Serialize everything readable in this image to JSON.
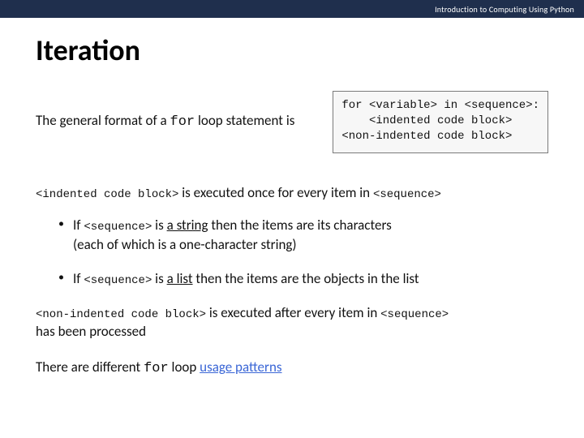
{
  "header": {
    "course": "Introduction to Computing Using Python"
  },
  "title": "Iteration",
  "intro": {
    "prefix": "The general format of a ",
    "kw": "for",
    "suffix": " loop statement is"
  },
  "syntax": {
    "line1": "for <variable> in <sequence>:",
    "line2": "    <indented code block>",
    "line3": "<non-indented code block>"
  },
  "p1": {
    "code": "<indented code block>",
    "mid": " is executed once for every item in ",
    "tail": "<sequence>"
  },
  "bullets": {
    "b1": {
      "lead": "If ",
      "seq": "<sequence>",
      "mid": " is ",
      "kind": "a string",
      "rest1": " then the items are its characters",
      "rest2": "(each of which is a one-character string)"
    },
    "b2": {
      "lead": "If ",
      "seq": "<sequence>",
      "mid": " is ",
      "kind": "a list",
      "rest": " then the items are the objects in the list"
    }
  },
  "p2": {
    "code": "<non-indented code block>",
    "mid": " is executed after every item in ",
    "tail": "<sequence>",
    "line2": "has been processed"
  },
  "p3": {
    "prefix": "There are different ",
    "kw": "for",
    "mid": " loop ",
    "link": "usage patterns"
  }
}
